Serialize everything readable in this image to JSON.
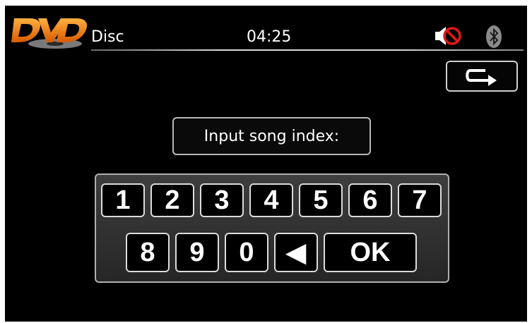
{
  "app": {
    "logo_text": "DVD"
  },
  "header": {
    "source": "Disc",
    "clock": "04:25",
    "icons": [
      "mute-icon",
      "bluetooth-icon"
    ]
  },
  "toolbar": {
    "back_icon": "return-arrow-icon"
  },
  "prompt": {
    "label": "Input song index:"
  },
  "keypad": {
    "row1": [
      "1",
      "2",
      "3",
      "4",
      "5",
      "6",
      "7"
    ],
    "row2": [
      "8",
      "9",
      "0"
    ],
    "backspace": "◀",
    "ok": "OK"
  },
  "colors": {
    "background": "#000000",
    "text": "#ffffff",
    "logo_orange": "#f07a10",
    "mute_red": "#e01818"
  }
}
